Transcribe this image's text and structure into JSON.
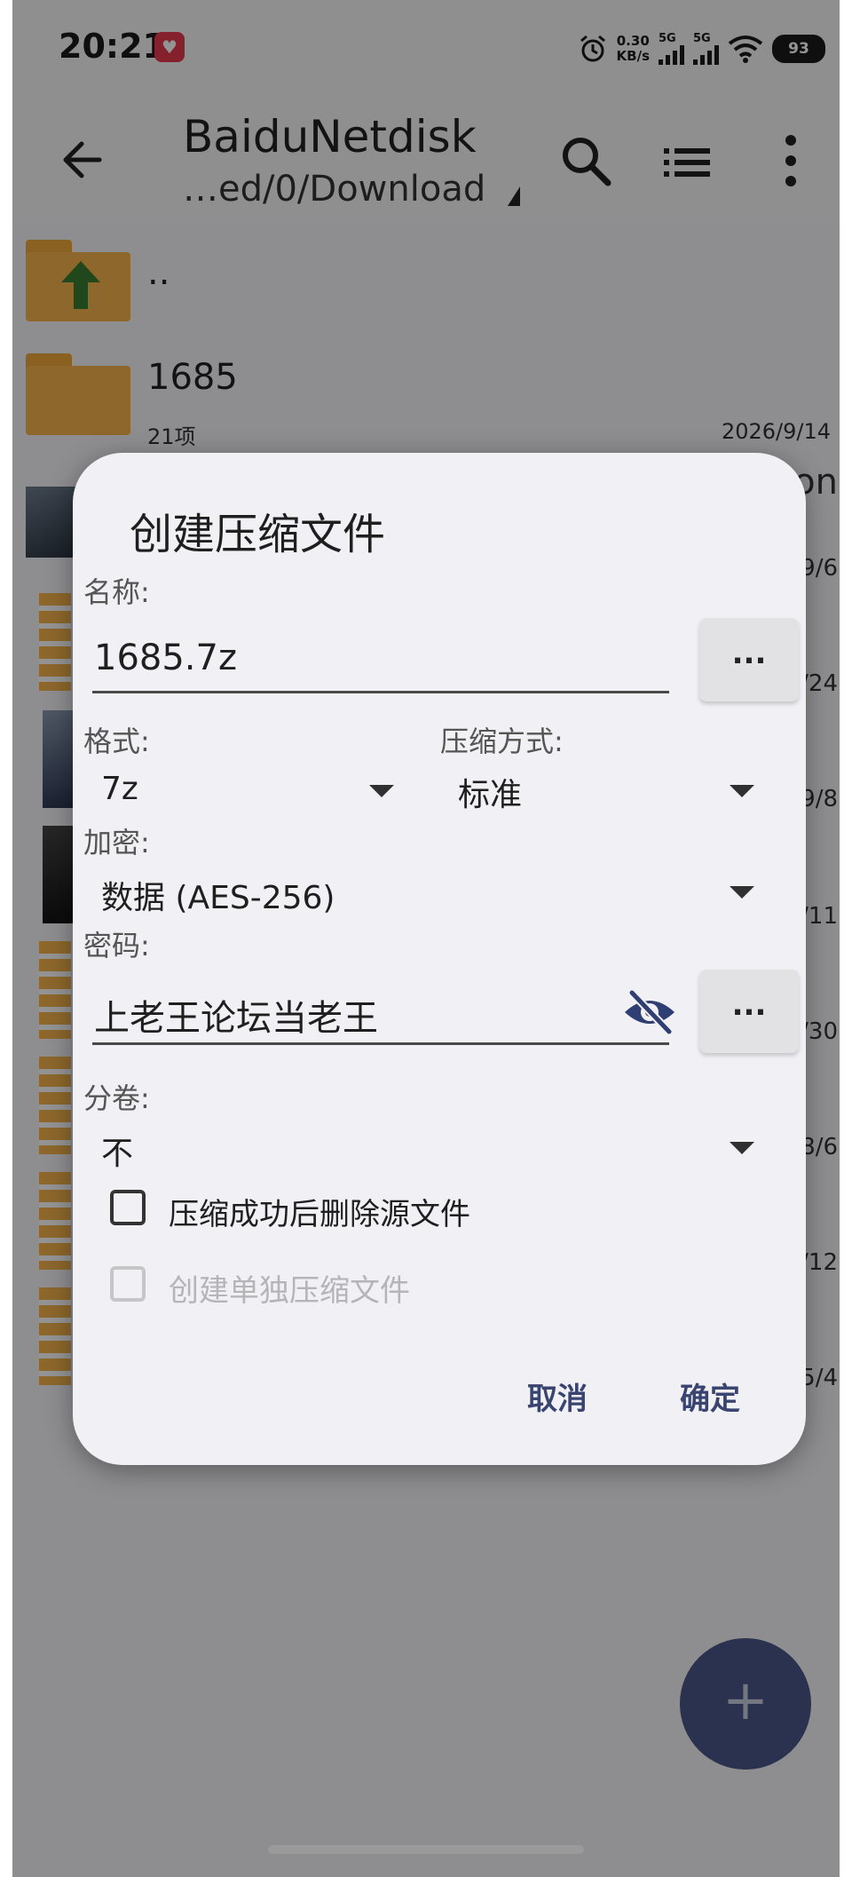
{
  "status_bar": {
    "time": "20:21",
    "net_speed_value": "0.30",
    "net_speed_unit": "KB/s",
    "sim1": "5G",
    "sim2": "5G",
    "battery": "93"
  },
  "app_bar": {
    "title": "BaiduNetdisk",
    "path": "…ed/0/Download"
  },
  "files": [
    {
      "name": "..",
      "meta": "",
      "date": ""
    },
    {
      "name": "1685",
      "meta": "21项",
      "date": "2026/9/14"
    }
  ],
  "obscured_fragments": [
    "on",
    "/9/6",
    "7/24",
    "/9/8",
    "9/11",
    "7/30",
    "/8/6",
    "3/12",
    "/5/4"
  ],
  "dialog": {
    "title": "创建压缩文件",
    "name_label": "名称:",
    "name_value": "1685.7z",
    "browse_label": "...",
    "format_label": "格式:",
    "format_value": "7z",
    "method_label": "压缩方式:",
    "method_value": "标准",
    "encryption_label": "加密:",
    "encryption_value": "数据 (AES-256)",
    "password_label": "密码:",
    "password_value": "上老王论坛当老王",
    "password_more_label": "...",
    "split_label": "分卷:",
    "split_value": "不",
    "delete_source_label": "压缩成功后删除源文件",
    "delete_source_checked": false,
    "separate_archive_label": "创建单独压缩文件",
    "separate_archive_checked": false,
    "separate_archive_enabled": false,
    "cancel_label": "取消",
    "ok_label": "确定"
  },
  "fab": {
    "icon": "plus-icon",
    "label": "+"
  },
  "colors": {
    "folder": "#f3b24c",
    "fab": "#4a5688",
    "dialog_button_text": "#3a4470",
    "eye_icon": "#2f3f74"
  }
}
